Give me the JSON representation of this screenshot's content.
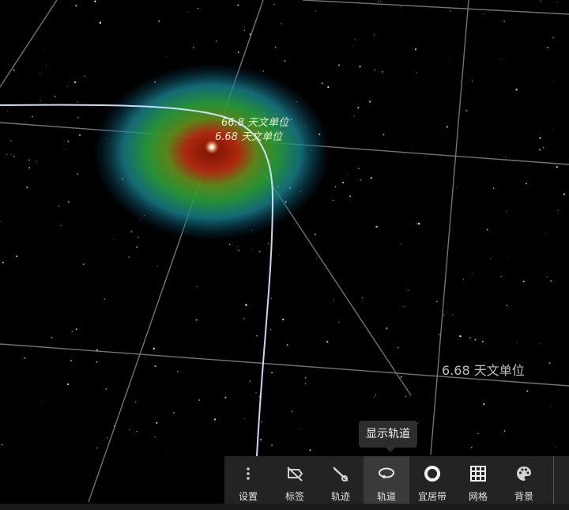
{
  "scene": {
    "labels": {
      "orbit_label_1": "66.8 天文单位",
      "orbit_label_2": "6.68 天文单位",
      "grid_label": "6.68 天文单位"
    }
  },
  "tooltip": {
    "text": "显示轨道"
  },
  "toolbar": {
    "items": [
      {
        "label": "设置",
        "icon": "more-vertical-icon"
      },
      {
        "label": "标签",
        "icon": "label-off-icon"
      },
      {
        "label": "轨迹",
        "icon": "trail-off-icon"
      },
      {
        "label": "轨道",
        "icon": "orbit-icon",
        "active": true
      },
      {
        "label": "宜居带",
        "icon": "ring-icon"
      },
      {
        "label": "网格",
        "icon": "grid-icon"
      },
      {
        "label": "背景",
        "icon": "palette-icon"
      }
    ]
  },
  "colors": {
    "toolbar_bg": "#232323",
    "active_bg": "#3a3a3a",
    "orbit": "#cfe6ff"
  }
}
